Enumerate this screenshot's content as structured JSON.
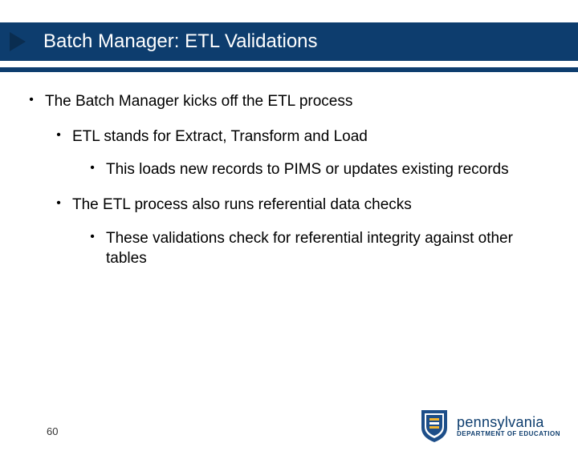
{
  "title": "Batch Manager: ETL Validations",
  "bullets": {
    "l1_0": "The Batch Manager kicks off the ETL process",
    "l2_0": "ETL stands for Extract, Transform and Load",
    "l3_0": "This loads new records to PIMS or updates existing records",
    "l2_1": "The ETL process also runs referential data checks",
    "l3_1": "These validations check for referential integrity against other tables"
  },
  "pageNumber": "60",
  "logo": {
    "main": "pennsylvania",
    "sub": "DEPARTMENT OF EDUCATION"
  }
}
